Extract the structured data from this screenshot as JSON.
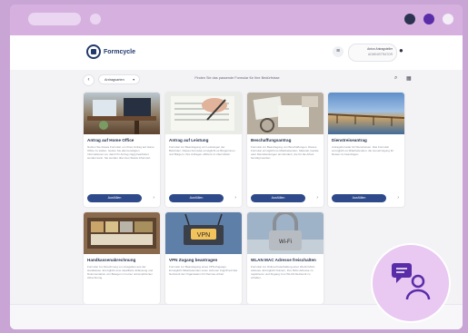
{
  "app": {
    "logo_text": "Formcycle",
    "user_name": "Anton Antragsteller",
    "user_role": "ADMINISTRATOR"
  },
  "toolbar": {
    "back_icon": "chevron-left-icon",
    "filter_label": "Antragsarten",
    "hint": "Finden Sie das passende Formular für Ihre Bedürfnisse"
  },
  "cards": [
    {
      "title": "Antrag auf Home Office",
      "desc": "Nutzen Sie dieses Formular, um Ihren Antrag auf Home Office zu stellen. Geben Sie alle benötigten Informationen an, damit Ihr Antrag zügig bearbeitet werden kann. Sie werden über den Status informiert.",
      "button": "Ausfüllen"
    },
    {
      "title": "Antrag auf Leistung",
      "desc": "Formular zur Beantragung von Leistungen der Behörden. Dieses Formular ermöglicht es Bürgerinnen und Bürgern, Ihre Anfragen effizient zu übermitteln.",
      "button": "Ausfüllen"
    },
    {
      "title": "Beschaffungsantrag",
      "desc": "Formular zur Beantragung von Beschaffungen. Dieses Formular ermöglicht es Mitarbeitenden, Material, Geräte oder Dienstleistungen anzufordern, die für die Arbeit benötigt werden.",
      "button": "Ausfüllen"
    },
    {
      "title": "Dienstreiseantrag",
      "desc": "Antragsformular für Dienstreisen. Das Formular ermöglicht es Mitarbeitenden, die Genehmigung für Reisen zu beantragen.",
      "button": "Ausfüllen"
    },
    {
      "title": "Handkassenabrechnung",
      "desc": "Formular zur Abrechnung von Ausgaben aus der Handkasse. Ermöglicht eine detaillierte Erfassung und Dokumentation von Belegen mit einer unkomplizierten Abrechnung.",
      "button": "Ausfüllen"
    },
    {
      "title": "VPN Zugang beantragen",
      "desc": "Formular zur Beantragung eines VPN-Zugangs. Ermöglicht Mitarbeitenden einen sicheren Zugriff auf das Netzwerk der Organisation für Remote-Arbeit.",
      "button": "Ausfüllen"
    },
    {
      "title": "WLAN MAC Adresse freischalten",
      "desc": "Formular zur Online-Freischaltung einer WLAN MAC-Adresse. Ermöglicht Nutzern, Ihre MAC-Adresse zu registrieren und Zugang zum WLAN-Netzwerk zu erhalten.",
      "button": "Ausfüllen"
    }
  ],
  "icons": {
    "menu": "hamburger-icon",
    "user": "user-icon",
    "search": "search-icon",
    "grid": "grid-icon",
    "chat": "chat-support-icon"
  },
  "colors": {
    "accent": "#2f4a8a",
    "frame": "#d8b4e2",
    "background": "#c9a5d6"
  }
}
